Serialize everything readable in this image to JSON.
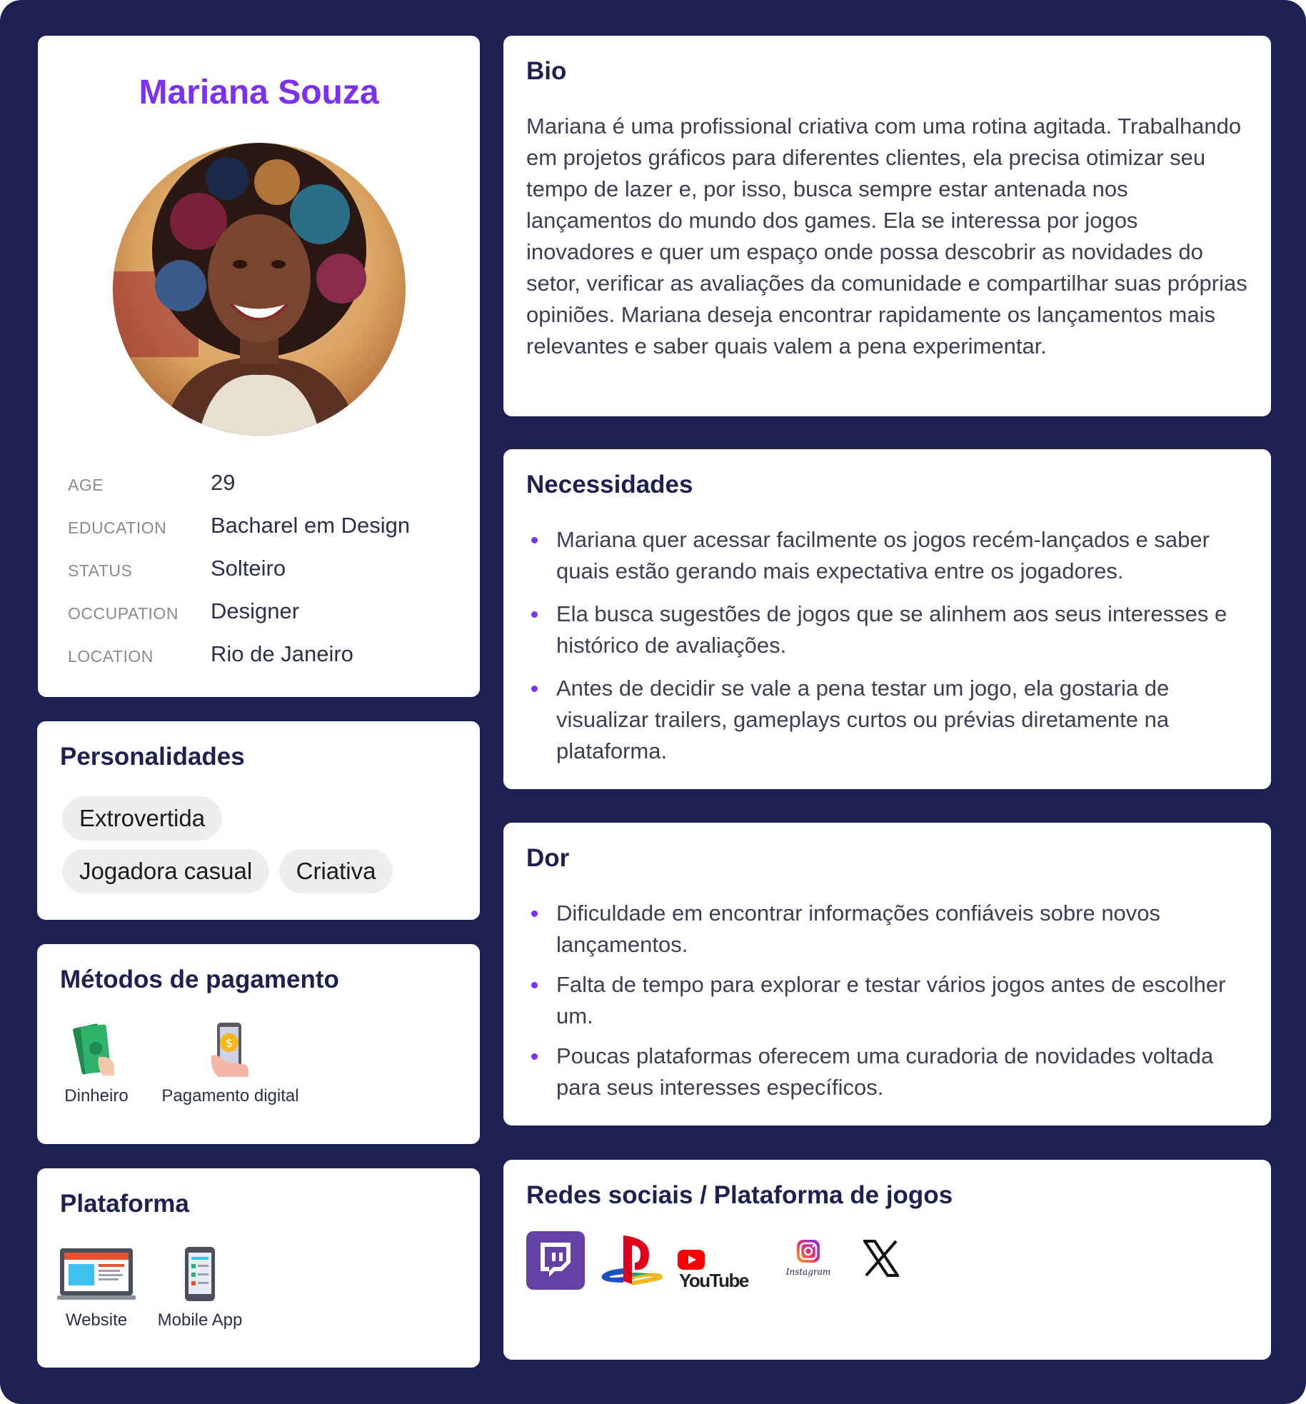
{
  "persona": {
    "name": "Mariana Souza",
    "details": [
      {
        "label": "AGE",
        "value": "29"
      },
      {
        "label": "EDUCATION",
        "value": "Bacharel em Design"
      },
      {
        "label": "STATUS",
        "value": "Solteiro"
      },
      {
        "label": "OCCUPATION",
        "value": "Designer"
      },
      {
        "label": "LOCATION",
        "value": "Rio de Janeiro"
      }
    ]
  },
  "personality": {
    "title": "Personalidades",
    "tags": [
      "Extrovertida",
      "Jogadora casual",
      "Criativa"
    ]
  },
  "payment": {
    "title": "Métodos de pagamento",
    "methods": [
      {
        "label": "Dinheiro",
        "icon": "cash-icon"
      },
      {
        "label": "Pagamento digital",
        "icon": "digital-payment-icon"
      }
    ]
  },
  "platform": {
    "title": "Plataforma",
    "items": [
      {
        "label": "Website",
        "icon": "website-icon"
      },
      {
        "label": "Mobile App",
        "icon": "mobile-app-icon"
      }
    ]
  },
  "bio": {
    "title": "Bio",
    "text": "Mariana é uma profissional criativa com uma rotina agitada. Trabalhando em projetos gráficos para diferentes clientes, ela precisa otimizar seu tempo de lazer e, por isso, busca sempre estar antenada nos lançamentos do mundo dos games. Ela se interessa por jogos inovadores e quer um espaço onde possa descobrir as novidades do setor, verificar as avaliações da comunidade e compartilhar suas próprias opiniões. Mariana deseja encontrar rapidamente os lançamentos mais relevantes e saber quais valem a pena experimentar."
  },
  "needs": {
    "title": "Necessidades",
    "items": [
      "Mariana quer acessar facilmente os jogos recém-lançados e saber quais estão gerando mais expectativa entre os jogadores.",
      "Ela busca sugestões de jogos que se alinhem aos seus interesses e histórico de avaliações.",
      "Antes de decidir se vale a pena testar um jogo, ela gostaria de visualizar trailers, gameplays curtos ou prévias diretamente na plataforma."
    ]
  },
  "pain": {
    "title": "Dor",
    "items": [
      "Dificuldade em encontrar informações confiáveis sobre novos lançamentos.",
      "Falta de tempo para explorar e testar vários jogos antes de escolher um.",
      "Poucas plataformas oferecem uma curadoria de novidades voltada para seus interesses específicos."
    ]
  },
  "social": {
    "title": "Redes sociais / Plataforma de jogos",
    "youtube_text": "YouTube",
    "instagram_text": "Instagram",
    "logos": [
      "twitch-icon",
      "playstation-icon",
      "youtube-icon",
      "instagram-icon",
      "x-icon"
    ]
  },
  "colors": {
    "background": "#1d2152",
    "accent": "#7b2ff7",
    "heading": "#1d2152",
    "twitch": "#6441a5",
    "youtube": "#ff0000"
  }
}
